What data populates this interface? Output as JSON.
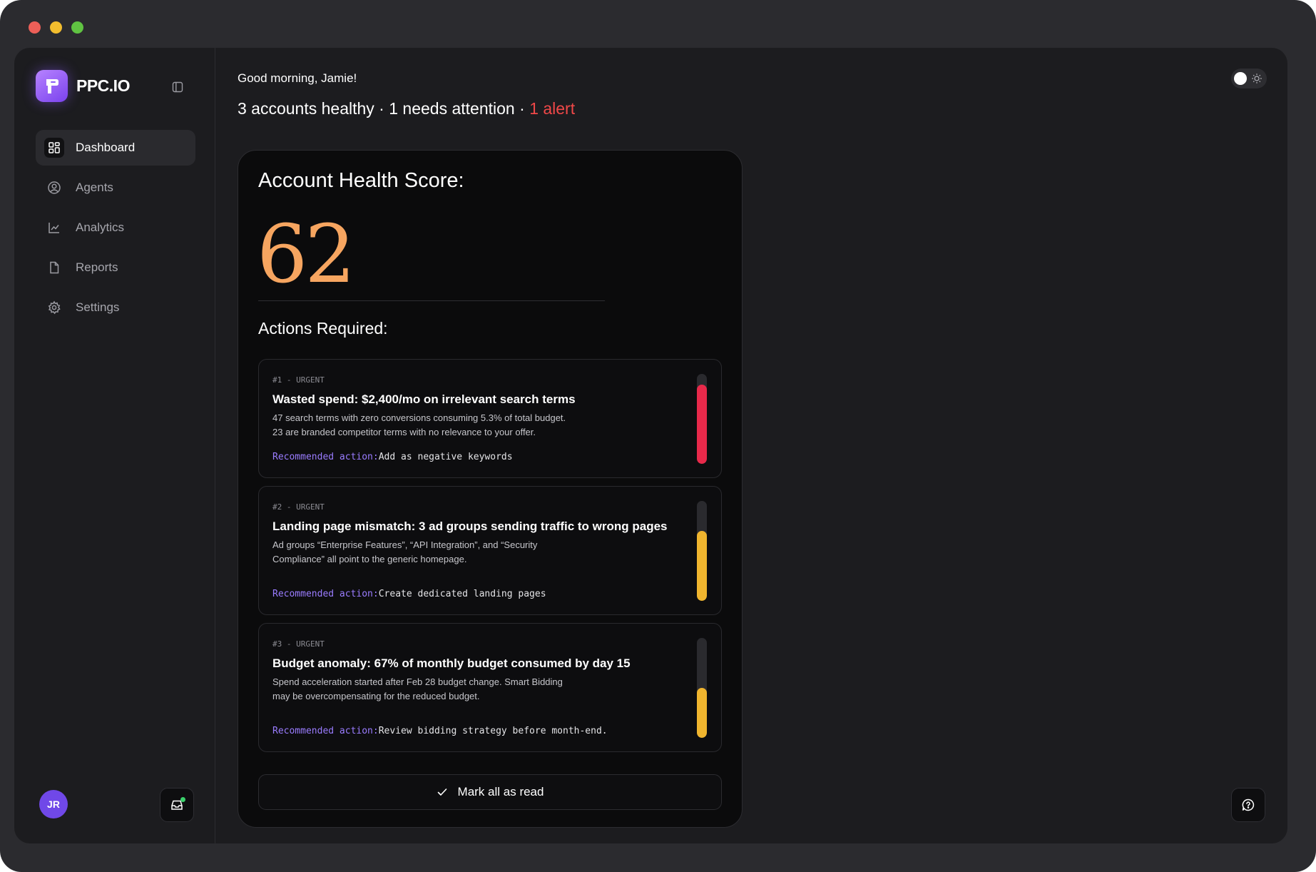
{
  "brand": {
    "name": "PPC.IO",
    "accent": "#8b5cf6"
  },
  "nav": [
    {
      "label": "Dashboard",
      "icon": "dashboard-grid-icon",
      "active": true
    },
    {
      "label": "Agents",
      "icon": "user-circle-icon",
      "active": false
    },
    {
      "label": "Analytics",
      "icon": "line-chart-icon",
      "active": false
    },
    {
      "label": "Reports",
      "icon": "document-icon",
      "active": false
    },
    {
      "label": "Settings",
      "icon": "gear-icon",
      "active": false
    }
  ],
  "user": {
    "initials": "JR",
    "avatar_color": "#7048e8"
  },
  "header": {
    "greeting": "Good morning, Jamie!",
    "summary_healthy": "3 accounts healthy",
    "summary_attention": "1 needs attention",
    "summary_sep": " · ",
    "summary_alert": "1 alert",
    "alert_color": "#f04848"
  },
  "health": {
    "title": "Account Health Score:",
    "score": "62",
    "score_color": "#f6a560"
  },
  "actions_section": {
    "title": "Actions Required:",
    "items": [
      {
        "meta": "#1 - URGENT",
        "title": "Wasted spend: $2,400/mo on irrelevant search terms",
        "desc_line1": "47 search terms with zero conversions consuming 5.3% of total budget.",
        "desc_line2": "23 are branded competitor terms with no relevance to your offer.",
        "rec_label": "Recommended action:",
        "rec_value": "Add as negative keywords",
        "severity_fraction": 0.88,
        "severity_color": "#e8294a"
      },
      {
        "meta": "#2 - URGENT",
        "title": "Landing page mismatch: 3 ad groups sending traffic to wrong pages",
        "desc_line1": "Ad groups “Enterprise Features”, “API Integration”, and “Security",
        "desc_line2": "Compliance” all point to the generic homepage.",
        "rec_label": "Recommended action:",
        "rec_value": "Create dedicated landing pages",
        "severity_fraction": 0.7,
        "severity_color": "#f0b52e"
      },
      {
        "meta": "#3 - URGENT",
        "title": "Budget anomaly: 67% of monthly budget consumed by day 15",
        "desc_line1": "Spend acceleration started after Feb 28 budget change. Smart Bidding",
        "desc_line2": "may be overcompensating for the reduced budget.",
        "rec_label": "Recommended action:",
        "rec_value": "Review bidding strategy before month-end.",
        "severity_fraction": 0.5,
        "severity_color": "#f0b52e"
      }
    ]
  },
  "mark_all": {
    "label": "Mark all as read",
    "icon": "check-icon"
  }
}
